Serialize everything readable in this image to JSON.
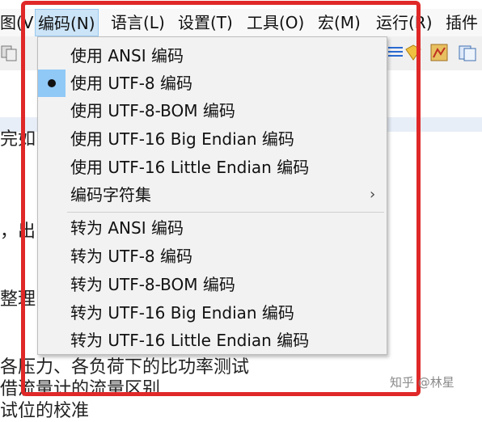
{
  "menubar": {
    "items": [
      {
        "label": "图(V)"
      },
      {
        "label": "编码(N)",
        "active": true
      },
      {
        "label": "语言(L)"
      },
      {
        "label": "设置(T)"
      },
      {
        "label": "工具(O)"
      },
      {
        "label": "宏(M)"
      },
      {
        "label": "运行(R)"
      },
      {
        "label": "插件"
      }
    ]
  },
  "encoding_menu": {
    "items": [
      {
        "label": "使用 ANSI 编码"
      },
      {
        "label": "使用 UTF-8 编码",
        "checked": true
      },
      {
        "label": "使用 UTF-8-BOM 编码"
      },
      {
        "label": "使用 UTF-16 Big Endian 编码"
      },
      {
        "label": "使用 UTF-16 Little Endian 编码"
      },
      {
        "label": "编码字符集",
        "submenu": true,
        "submenu_arrow": "›"
      },
      {
        "label": "转为 ANSI 编码"
      },
      {
        "label": "转为 UTF-8 编码"
      },
      {
        "label": "转为 UTF-8-BOM 编码"
      },
      {
        "label": "转为 UTF-16 Big Endian 编码"
      },
      {
        "label": "转为 UTF-16 Little Endian 编码"
      }
    ]
  },
  "editor": {
    "lines": [
      "完如",
      "，出",
      "整理",
      "各压力、各负荷下的比功率测试",
      "借流量计的流量区别",
      "试位的校准"
    ]
  },
  "watermark": {
    "text": "知乎 @林星"
  },
  "colors": {
    "highlight_frame": "#e02828",
    "menu_active": "#cce4f7",
    "check_cell": "#90c8f6"
  }
}
